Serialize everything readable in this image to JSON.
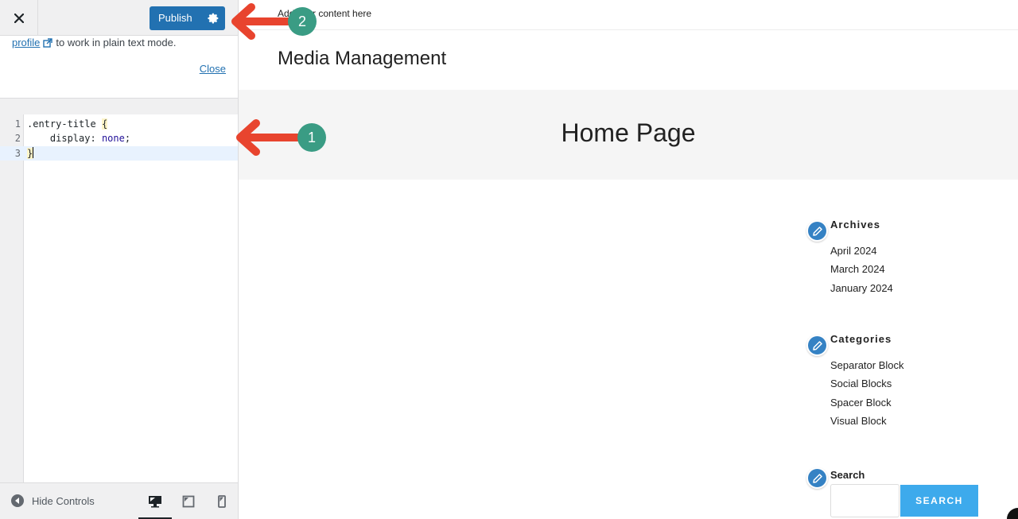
{
  "customizer": {
    "close_icon": "close-icon",
    "publish_label": "Publish",
    "settings_icon": "gear-icon",
    "notice": {
      "link_text": "profile",
      "link_icon": "external-link-icon",
      "text": "to work in plain text mode.",
      "close_label": "Close"
    },
    "code_editor": {
      "lines": [
        {
          "number": "1",
          "text": ".entry-title {"
        },
        {
          "number": "2",
          "text": "    display: none;"
        },
        {
          "number": "3",
          "text": "}"
        }
      ],
      "property": "display:",
      "value": "none",
      "selector": ".entry-title",
      "active_line": 3
    },
    "footer": {
      "hide_controls_label": "Hide Controls",
      "devices": [
        {
          "name": "desktop",
          "icon": "desktop-icon",
          "active": true
        },
        {
          "name": "tablet",
          "icon": "tablet-icon",
          "active": false
        },
        {
          "name": "mobile",
          "icon": "mobile-icon",
          "active": false
        }
      ]
    }
  },
  "preview": {
    "topbar_text": "Add your content here",
    "site_title": "Media Management",
    "hero_title": "Home Page",
    "widgets": {
      "archives": {
        "title": "Archives",
        "items": [
          "April 2024",
          "March 2024",
          "January 2024"
        ]
      },
      "categories": {
        "title": "Categories",
        "items": [
          "Separator Block",
          "Social Blocks",
          "Spacer Block",
          "Visual Block"
        ]
      },
      "search": {
        "title": "Search",
        "input_value": "",
        "button_label": "SEARCH"
      }
    }
  },
  "annotations": [
    {
      "number": "1",
      "points_to": "custom CSS code"
    },
    {
      "number": "2",
      "points_to": "Publish button"
    }
  ],
  "colors": {
    "wp_blue": "#2271b1",
    "search_button": "#3daaec",
    "annotation_arrow": "#e8442e",
    "annotation_badge": "#3a9c84",
    "edit_shortcut": "#3582c4"
  }
}
